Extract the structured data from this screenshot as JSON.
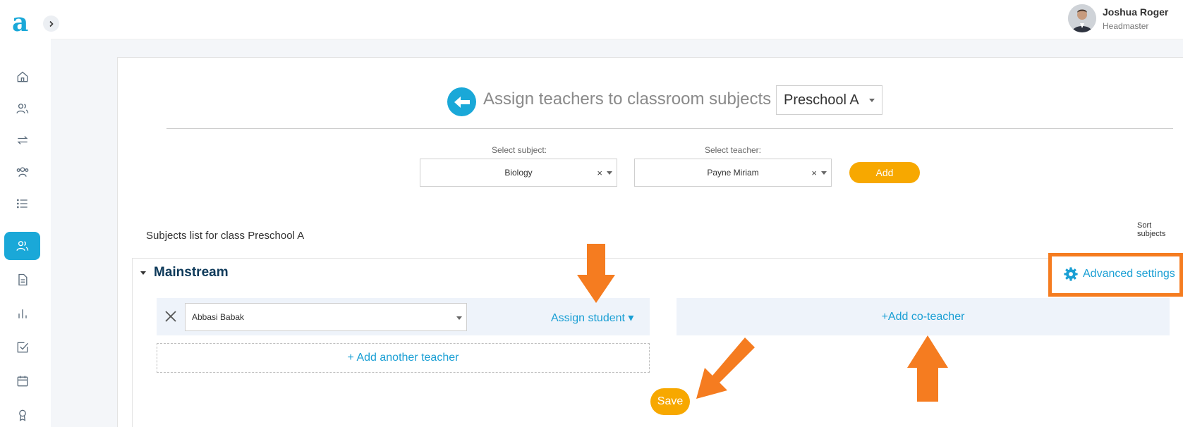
{
  "app": {
    "logo": "a"
  },
  "user": {
    "name": "Joshua Roger",
    "role": "Headmaster"
  },
  "sidebar": {
    "items": [
      {
        "icon": "home-icon"
      },
      {
        "icon": "users-icon"
      },
      {
        "icon": "transfer-icon"
      },
      {
        "icon": "group-icon"
      },
      {
        "icon": "list-icon"
      },
      {
        "icon": "teachers-icon",
        "active": true
      },
      {
        "icon": "document-icon"
      },
      {
        "icon": "chart-icon"
      },
      {
        "icon": "checkbox-icon"
      },
      {
        "icon": "calendar-icon"
      },
      {
        "icon": "award-icon"
      }
    ]
  },
  "header": {
    "title": "Assign teachers to classroom subjects",
    "class_selected": "Preschool A"
  },
  "form": {
    "subject_label": "Select subject:",
    "subject_value": "Biology",
    "teacher_label": "Select teacher:",
    "teacher_value": "Payne Miriam",
    "clear_glyph": "×",
    "add_label": "Add"
  },
  "list": {
    "title": "Subjects list for class Preschool A",
    "sort_label_1": "Sort",
    "sort_label_2": "subjects"
  },
  "group": {
    "name": "Mainstream",
    "advanced_settings": "Advanced settings",
    "teacher_value": "Abbasi Babak",
    "assign_student": "Assign student ▾",
    "add_coteacher": "+Add co-teacher",
    "add_another_teacher": "+ Add another teacher",
    "save_label": "Save"
  },
  "colors": {
    "accent": "#1aa8d8",
    "button": "#f7a800",
    "annotation": "#f57c20"
  }
}
